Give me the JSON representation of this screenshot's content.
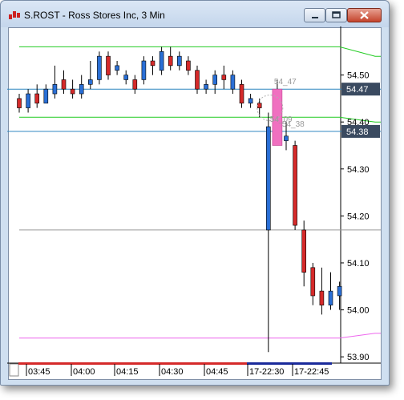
{
  "window": {
    "title": "S.ROST - Ross Stores Inc, 3 Min",
    "controls": {
      "minimize": "minimize",
      "maximize": "maximize",
      "close": "close"
    }
  },
  "colors": {
    "up_candle": "#2a6fd6",
    "down_candle": "#d52a2a",
    "price_line": "#2f87c0",
    "green_band": "#22cc22",
    "magenta_band": "#ee66ee",
    "gray_line": "#999999",
    "badge_bg": "#3a4a60",
    "highlight_candle": "#f070c0"
  },
  "chart_data": {
    "type": "candlestick",
    "ylim": [
      53.89,
      54.6
    ],
    "y_ticks": [
      54.5,
      54.4,
      54.3,
      54.2,
      54.1,
      54.0,
      53.9
    ],
    "y_tick_labels": [
      "54.50",
      "54.40",
      "54.30",
      "54.20",
      "54.10",
      "54.00",
      "53.90"
    ],
    "x_tick_labels": [
      "03:45",
      "04:00",
      "04:15",
      "04:30",
      "04:45",
      "17-22:30",
      "17-22:45"
    ],
    "price_badges": [
      "54.47",
      "54.38"
    ],
    "annotations": [
      "54_47",
      "54_38",
      "54_09"
    ],
    "candles": [
      {
        "o": 54.45,
        "h": 54.46,
        "l": 54.42,
        "c": 54.43
      },
      {
        "o": 54.43,
        "h": 54.47,
        "l": 54.42,
        "c": 54.46
      },
      {
        "o": 54.46,
        "h": 54.48,
        "l": 54.43,
        "c": 54.44
      },
      {
        "o": 54.44,
        "h": 54.48,
        "l": 54.44,
        "c": 54.47
      },
      {
        "o": 54.46,
        "h": 54.52,
        "l": 54.45,
        "c": 54.48
      },
      {
        "o": 54.49,
        "h": 54.51,
        "l": 54.46,
        "c": 54.47
      },
      {
        "o": 54.47,
        "h": 54.49,
        "l": 54.45,
        "c": 54.46
      },
      {
        "o": 54.46,
        "h": 54.5,
        "l": 54.45,
        "c": 54.48
      },
      {
        "o": 54.48,
        "h": 54.53,
        "l": 54.47,
        "c": 54.49
      },
      {
        "o": 54.49,
        "h": 54.55,
        "l": 54.48,
        "c": 54.54
      },
      {
        "o": 54.54,
        "h": 54.55,
        "l": 54.49,
        "c": 54.5
      },
      {
        "o": 54.51,
        "h": 54.53,
        "l": 54.5,
        "c": 54.52
      },
      {
        "o": 54.49,
        "h": 54.51,
        "l": 54.48,
        "c": 54.5
      },
      {
        "o": 54.49,
        "h": 54.5,
        "l": 54.46,
        "c": 54.47
      },
      {
        "o": 54.49,
        "h": 54.54,
        "l": 54.48,
        "c": 54.53
      },
      {
        "o": 54.53,
        "h": 54.54,
        "l": 54.5,
        "c": 54.52
      },
      {
        "o": 54.51,
        "h": 54.56,
        "l": 54.5,
        "c": 54.55
      },
      {
        "o": 54.54,
        "h": 54.56,
        "l": 54.51,
        "c": 54.52
      },
      {
        "o": 54.52,
        "h": 54.55,
        "l": 54.51,
        "c": 54.54
      },
      {
        "o": 54.53,
        "h": 54.54,
        "l": 54.5,
        "c": 54.51
      },
      {
        "o": 54.51,
        "h": 54.52,
        "l": 54.46,
        "c": 54.47
      },
      {
        "o": 54.47,
        "h": 54.49,
        "l": 54.46,
        "c": 54.48
      },
      {
        "o": 54.48,
        "h": 54.51,
        "l": 54.46,
        "c": 54.5
      },
      {
        "o": 54.5,
        "h": 54.52,
        "l": 54.47,
        "c": 54.49
      },
      {
        "o": 54.47,
        "h": 54.51,
        "l": 54.46,
        "c": 54.5
      },
      {
        "o": 54.48,
        "h": 54.49,
        "l": 54.43,
        "c": 54.44
      },
      {
        "o": 54.44,
        "h": 54.46,
        "l": 54.43,
        "c": 54.45
      },
      {
        "o": 54.44,
        "h": 54.45,
        "l": 54.41,
        "c": 54.43
      },
      {
        "o": 54.17,
        "h": 54.42,
        "l": 53.91,
        "c": 54.39
      },
      {
        "o": 54.47,
        "h": 54.49,
        "l": 54.35,
        "c": 54.35
      },
      {
        "o": 54.36,
        "h": 54.4,
        "l": 54.34,
        "c": 54.37
      },
      {
        "o": 54.35,
        "h": 54.36,
        "l": 54.17,
        "c": 54.18
      },
      {
        "o": 54.17,
        "h": 54.19,
        "l": 54.05,
        "c": 54.08
      },
      {
        "o": 54.09,
        "h": 54.1,
        "l": 54.01,
        "c": 54.03
      },
      {
        "o": 54.04,
        "h": 54.09,
        "l": 53.99,
        "c": 54.01
      },
      {
        "o": 54.01,
        "h": 54.08,
        "l": 54.0,
        "c": 54.04
      },
      {
        "o": 54.03,
        "h": 54.06,
        "l": 54.0,
        "c": 54.05
      }
    ],
    "lines": [
      {
        "name": "green_upper",
        "color": "green_band",
        "points": [
          [
            0,
            54.56
          ],
          [
            36,
            54.56
          ],
          [
            40,
            54.54
          ],
          [
            48,
            54.54
          ]
        ]
      },
      {
        "name": "green_lower",
        "color": "green_band",
        "points": [
          [
            0,
            54.41
          ],
          [
            36,
            54.41
          ],
          [
            40,
            54.4
          ],
          [
            48,
            54.4
          ]
        ]
      },
      {
        "name": "magenta_lower",
        "color": "magenta_band",
        "points": [
          [
            0,
            53.94
          ],
          [
            36,
            53.94
          ],
          [
            40,
            53.95
          ],
          [
            48,
            53.95
          ]
        ]
      },
      {
        "name": "gray_level",
        "color": "gray_line",
        "points": [
          [
            0,
            54.17
          ],
          [
            48,
            54.17
          ]
        ]
      },
      {
        "name": "blue_47",
        "color": "price_line",
        "points": [
          [
            -2,
            54.47
          ],
          [
            50,
            54.47
          ]
        ]
      },
      {
        "name": "blue_38",
        "color": "price_line",
        "points": [
          [
            -2,
            54.38
          ],
          [
            50,
            54.38
          ]
        ]
      }
    ]
  }
}
